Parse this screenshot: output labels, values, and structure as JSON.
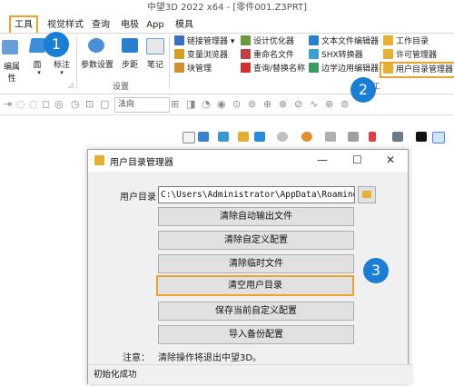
{
  "app": {
    "title": "中望3D 2022 x64 - [零件001.Z3PRT]"
  },
  "menu": {
    "tabs": [
      {
        "label": "工具"
      },
      {
        "label": "视觉样式"
      },
      {
        "label": "查询"
      },
      {
        "label": "电极"
      },
      {
        "label": "App"
      },
      {
        "label": "模具"
      }
    ]
  },
  "ribbon": {
    "left_buttons": [
      {
        "label": "编属性"
      },
      {
        "label": "面"
      },
      {
        "label": "标注"
      }
    ],
    "settings_group": {
      "title": "设置",
      "buttons": [
        {
          "label": "参数设置"
        },
        {
          "label": "步距"
        },
        {
          "label": "笔记"
        }
      ]
    },
    "utility_group": {
      "title": "实用工",
      "col1": [
        {
          "label": "链接管理器"
        },
        {
          "label": "变量浏览器"
        },
        {
          "label": "块管理"
        }
      ],
      "col2": [
        {
          "label": "设计优化器"
        },
        {
          "label": "重命名文件"
        },
        {
          "label": "查询/替换名称"
        }
      ],
      "col3": [
        {
          "label": "文本文件编辑器"
        },
        {
          "label": "SHX转换器"
        },
        {
          "label": "边学边用编辑器"
        }
      ],
      "col4": [
        {
          "label": "工作目录"
        },
        {
          "label": "许可管理器"
        },
        {
          "label": "用户目录管理器"
        }
      ]
    }
  },
  "toolbar2": {
    "view_combo": "法向"
  },
  "callouts": {
    "one": "1",
    "two": "2",
    "three": "3"
  },
  "dialog": {
    "title": "用户目录管理器",
    "controls": {
      "minimize": "—",
      "maximize": "☐",
      "close": "✕"
    },
    "dir_label": "用户目录",
    "dir_value": "C:\\Users\\Administrator\\AppData\\Roaming\\ZWSOFT",
    "buttons": [
      {
        "label": "清除自动输出文件"
      },
      {
        "label": "清除自定义配置"
      },
      {
        "label": "清除临时文件"
      },
      {
        "label": "清空用户目录"
      },
      {
        "label": "保存当前自定义配置"
      },
      {
        "label": "导入备份配置"
      }
    ],
    "note_label": "注意：",
    "note_text": "清除操作将退出中望3D。",
    "status": "初始化成功"
  },
  "colors": {
    "accent_highlight": "#f0a030",
    "callout": "#1a7fd4"
  }
}
